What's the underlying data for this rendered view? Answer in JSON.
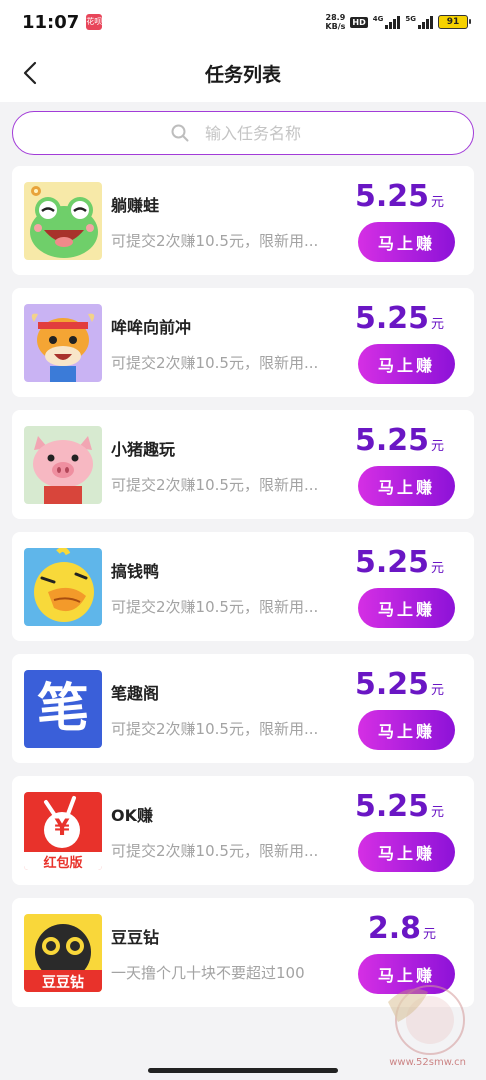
{
  "status_bar": {
    "time": "11:07",
    "app_badge": "花呗",
    "net_speed_value": "28.9",
    "net_speed_unit": "KB/s",
    "hd": "HD",
    "sim1": "4G",
    "sim2": "5G",
    "battery": "91"
  },
  "nav": {
    "title": "任务列表"
  },
  "search": {
    "placeholder": "输入任务名称"
  },
  "tasks": [
    {
      "name": "躺赚蛙",
      "desc": "可提交2次赚10.5元，限新用...",
      "price": "5.25",
      "unit": "元",
      "button": "马上赚",
      "icon": "frog-icon"
    },
    {
      "name": "哞哞向前冲",
      "desc": "可提交2次赚10.5元，限新用...",
      "price": "5.25",
      "unit": "元",
      "button": "马上赚",
      "icon": "cow-icon"
    },
    {
      "name": "小猪趣玩",
      "desc": "可提交2次赚10.5元，限新用...",
      "price": "5.25",
      "unit": "元",
      "button": "马上赚",
      "icon": "pig-icon"
    },
    {
      "name": "搞钱鸭",
      "desc": "可提交2次赚10.5元，限新用...",
      "price": "5.25",
      "unit": "元",
      "button": "马上赚",
      "icon": "duck-icon"
    },
    {
      "name": "笔趣阁",
      "desc": "可提交2次赚10.5元，限新用...",
      "price": "5.25",
      "unit": "元",
      "button": "马上赚",
      "icon": "book-app-icon",
      "icon_char": "笔"
    },
    {
      "name": "OK赚",
      "desc": "可提交2次赚10.5元，限新用...",
      "price": "5.25",
      "unit": "元",
      "button": "马上赚",
      "icon": "ok-earn-icon",
      "icon_char": "¥",
      "icon_caption": "红包版"
    },
    {
      "name": "豆豆钻",
      "desc": "一天撸个几十块不要超过100",
      "price": "2.8",
      "unit": "元",
      "button": "马上赚",
      "icon": "doudou-icon",
      "icon_caption": "豆豆钻"
    }
  ],
  "watermark": {
    "text": "www.52smw.cn"
  },
  "colors": {
    "accent": "#6a16c4",
    "button_gradient_start": "#d52fe4",
    "button_gradient_end": "#8d12d8",
    "search_border": "#a23cd8"
  }
}
